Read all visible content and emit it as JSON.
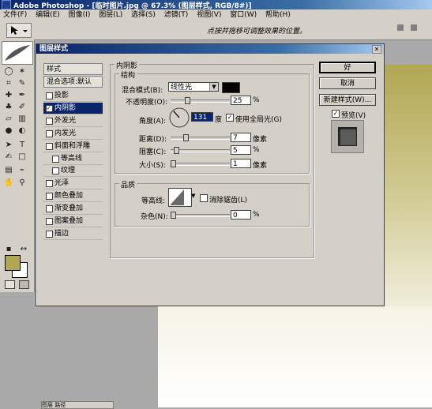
{
  "app": {
    "title": "Adobe Photoshop - [临时图片.jpg @ 67.3% (图层样式, RGB/8#)]"
  },
  "menu": [
    "文件(F)",
    "编辑(E)",
    "图像(I)",
    "图层(L)",
    "选择(S)",
    "滤镜(T)",
    "视图(V)",
    "窗口(W)",
    "帮助(H)"
  ],
  "options_bar": {
    "hint": "点按并拖移可调整效果的位置。"
  },
  "dialog": {
    "title": "图层样式",
    "styles_header": "样式",
    "blend_header": "混合选项:默认",
    "items": [
      {
        "label": "投影",
        "checked": false,
        "selected": false,
        "sub": false
      },
      {
        "label": "内阴影",
        "checked": true,
        "selected": true,
        "sub": false
      },
      {
        "label": "外发光",
        "checked": false,
        "selected": false,
        "sub": false
      },
      {
        "label": "内发光",
        "checked": false,
        "selected": false,
        "sub": false
      },
      {
        "label": "斜面和浮雕",
        "checked": false,
        "selected": false,
        "sub": false
      },
      {
        "label": "等高线",
        "checked": false,
        "selected": false,
        "sub": true
      },
      {
        "label": "纹理",
        "checked": false,
        "selected": false,
        "sub": true
      },
      {
        "label": "光泽",
        "checked": false,
        "selected": false,
        "sub": false
      },
      {
        "label": "颜色叠加",
        "checked": false,
        "selected": false,
        "sub": false
      },
      {
        "label": "渐变叠加",
        "checked": false,
        "selected": false,
        "sub": false
      },
      {
        "label": "图案叠加",
        "checked": false,
        "selected": false,
        "sub": false
      },
      {
        "label": "描边",
        "checked": false,
        "selected": false,
        "sub": false
      }
    ],
    "section_title": "内阴影",
    "structure": {
      "group": "结构",
      "blend_mode_label": "混合模式(B):",
      "blend_mode_value": "线性光",
      "shadow_color": "#000000",
      "opacity_label": "不透明度(O):",
      "opacity_value": "25",
      "opacity_unit": "%",
      "angle_label": "角度(A):",
      "angle_value": "131",
      "angle_unit": "度",
      "global_light_label": "使用全局光(G)",
      "global_light_checked": true,
      "distance_label": "距离(D):",
      "distance_value": "7",
      "distance_unit": "像素",
      "choke_label": "阻塞(C):",
      "choke_value": "5",
      "choke_unit": "%",
      "size_label": "大小(S):",
      "size_value": "1",
      "size_unit": "像素"
    },
    "quality": {
      "group": "品质",
      "contour_label": "等高线:",
      "anti_alias_label": "消除锯齿(L)",
      "noise_label": "杂色(N):",
      "noise_value": "0",
      "noise_unit": "%"
    },
    "buttons": {
      "ok": "好",
      "cancel": "取消",
      "new_style": "新建样式(W)...",
      "preview": "预览(V)"
    },
    "preview_checked": true
  },
  "swatches": {
    "foreground": "#b1a753",
    "background": "#ffffff"
  },
  "status_tab": "图层 路径"
}
